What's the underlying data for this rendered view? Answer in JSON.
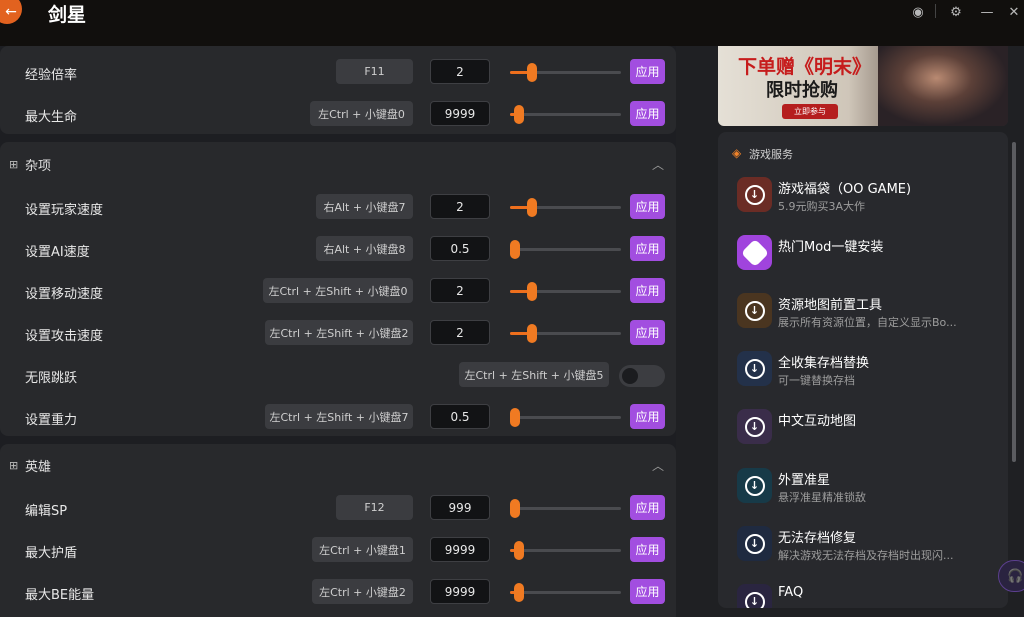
{
  "app": {
    "title": "剑星",
    "back_icon": "arrow-left-icon"
  },
  "window_controls": [
    {
      "name": "user-icon",
      "glyph": "◉"
    },
    {
      "name": "settings-icon",
      "glyph": "⚙"
    },
    {
      "name": "minimize-icon",
      "glyph": "—"
    },
    {
      "name": "close-icon",
      "glyph": "✕"
    }
  ],
  "accent": "#a24ee0",
  "slider_color": "#ee6f1d",
  "apply_label": "应用",
  "sections": {
    "top": {
      "rows": [
        {
          "label": "经验倍率",
          "hotkey": "F11",
          "value": "2",
          "level": 0.2
        },
        {
          "label": "最大生命",
          "hotkey": "左Ctrl + 小键盘0",
          "value": "9999",
          "level": 0.08
        }
      ]
    },
    "misc": {
      "title": "杂项",
      "rows": [
        {
          "label": "设置玩家速度",
          "hotkey": "右Alt + 小键盘7",
          "value": "2",
          "level": 0.2
        },
        {
          "label": "设置AI速度",
          "hotkey": "右Alt + 小键盘8",
          "value": "0.5",
          "level": 0.0
        },
        {
          "label": "设置移动速度",
          "hotkey": "左Ctrl + 左Shift + 小键盘0",
          "value": "2",
          "level": 0.2
        },
        {
          "label": "设置攻击速度",
          "hotkey": "左Ctrl + 左Shift + 小键盘2",
          "value": "2",
          "level": 0.2
        },
        {
          "label": "无限跳跃",
          "hotkey": "左Ctrl + 左Shift + 小键盘5",
          "toggle": false
        },
        {
          "label": "设置重力",
          "hotkey": "左Ctrl + 左Shift + 小键盘7",
          "value": "0.5",
          "level": 0.0
        }
      ]
    },
    "hero": {
      "title": "英雄",
      "rows": [
        {
          "label": "编辑SP",
          "hotkey": "F12",
          "value": "999",
          "level": 0.0
        },
        {
          "label": "最大护盾",
          "hotkey": "左Ctrl + 小键盘1",
          "value": "9999",
          "level": 0.08
        },
        {
          "label": "最大BE能量",
          "hotkey": "左Ctrl + 小键盘2",
          "value": "9999",
          "level": 0.08
        }
      ]
    }
  },
  "banner": {
    "line1": "下单赠《明末》",
    "line2": "限时抢购",
    "button": "立即参与"
  },
  "services": {
    "title": "游戏服务",
    "items": [
      {
        "title": "游戏福袋（OO GAME)",
        "sub": "5.9元购买3A大作",
        "bg": "#6b2c25"
      },
      {
        "title": "热门Mod一键安装",
        "sub": "",
        "bg": "#a044dd"
      },
      {
        "title": "资源地图前置工具",
        "sub": "展示所有资源位置，自定义显示Bo...",
        "bg": "#4a3520"
      },
      {
        "title": "全收集存档替换",
        "sub": "可一键替换存档",
        "bg": "#23314a"
      },
      {
        "title": "中文互动地图",
        "sub": "",
        "bg": "#3a2d4a"
      },
      {
        "title": "外置准星",
        "sub": "悬浮准星精准锁敌",
        "bg": "#173a48"
      },
      {
        "title": "无法存档修复",
        "sub": "解决游戏无法存档及存档时出现闪...",
        "bg": "#1f2a40"
      },
      {
        "title": "FAQ",
        "sub": "",
        "bg": "#2a2540"
      }
    ]
  }
}
